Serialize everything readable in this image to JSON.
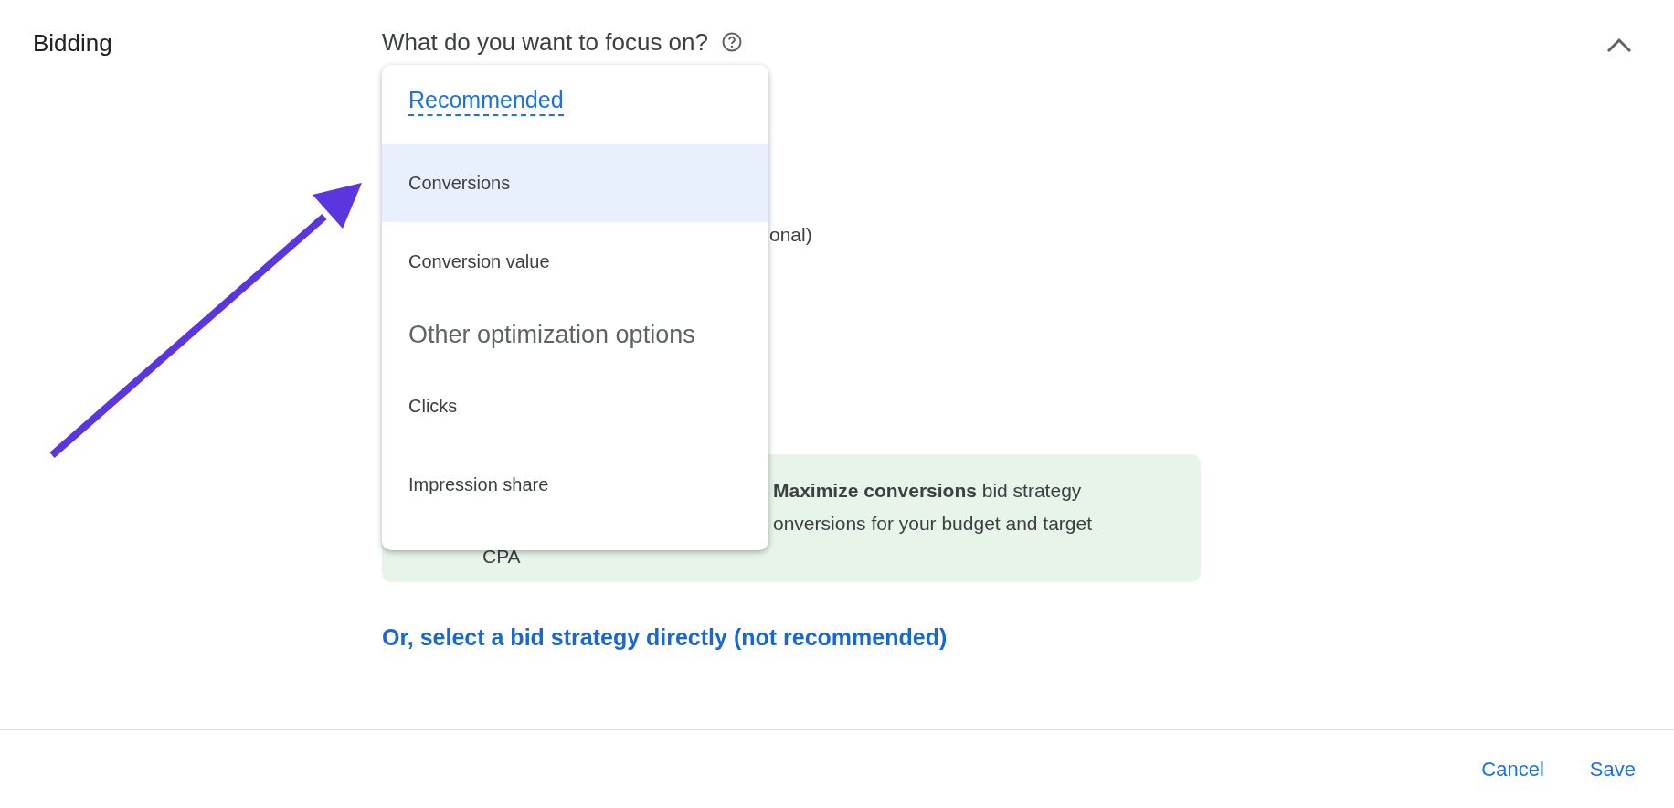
{
  "section": {
    "label": "Bidding",
    "question": "What do you want to focus on?",
    "expanded": true
  },
  "background_fragment": "onal)",
  "menu": {
    "groups": [
      {
        "heading": "Recommended",
        "kind": "recommended",
        "items": [
          {
            "label": "Conversions",
            "selected": true
          },
          {
            "label": "Conversion value",
            "selected": false
          }
        ]
      },
      {
        "heading": "Other optimization options",
        "kind": "other",
        "items": [
          {
            "label": "Clicks",
            "selected": false
          },
          {
            "label": "Impression share",
            "selected": false
          }
        ]
      }
    ]
  },
  "info_box": {
    "lines": [
      "**Maximize conversions** bid strategy",
      "onversions for your budget and target",
      "CPA"
    ]
  },
  "link": "Or, select a bid strategy directly (not recommended)",
  "footer": {
    "buttons": [
      "Cancel",
      "Save"
    ]
  }
}
